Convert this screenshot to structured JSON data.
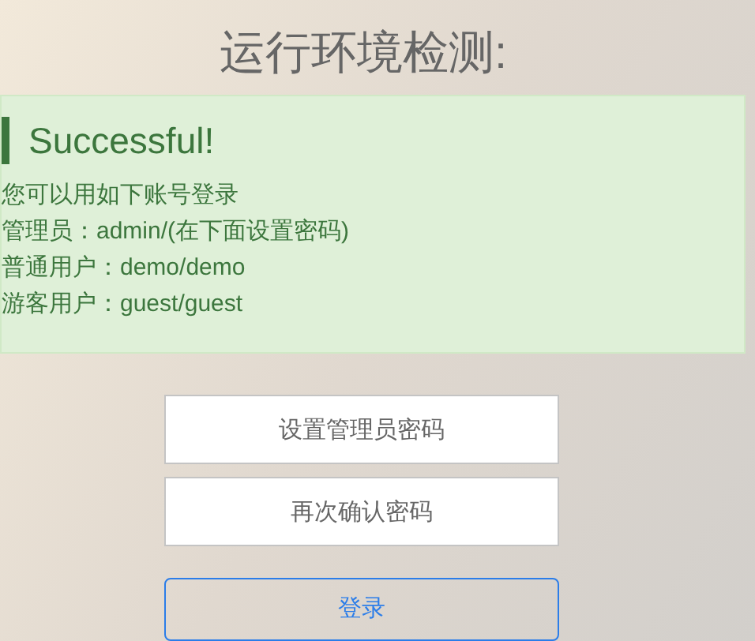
{
  "title": "运行环境检测:",
  "alert": {
    "heading": "Successful!",
    "lines": [
      "您可以用如下账号登录",
      "管理员：admin/(在下面设置密码)",
      "普通用户：demo/demo",
      "游客用户：guest/guest"
    ]
  },
  "fields": [
    {
      "placeholder": "设置管理员密码"
    },
    {
      "placeholder": "再次确认密码"
    }
  ],
  "button": {
    "label": "登录"
  }
}
